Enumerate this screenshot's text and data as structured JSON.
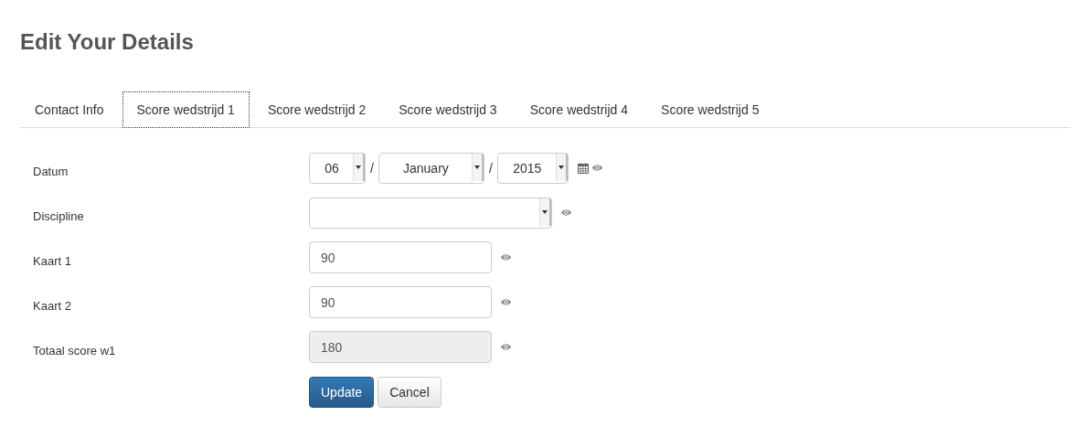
{
  "title": "Edit Your Details",
  "tabs": [
    {
      "label": "Contact Info",
      "selected": false
    },
    {
      "label": "Score wedstrijd 1",
      "selected": true
    },
    {
      "label": "Score wedstrijd 2",
      "selected": false
    },
    {
      "label": "Score wedstrijd 3",
      "selected": false
    },
    {
      "label": "Score wedstrijd 4",
      "selected": false
    },
    {
      "label": "Score wedstrijd 5",
      "selected": false
    }
  ],
  "fields": [
    {
      "kind": "date",
      "label": "Datum",
      "parts": [
        {
          "value": "06"
        },
        {
          "value": "January"
        },
        {
          "value": "2015"
        }
      ],
      "separator": "/"
    },
    {
      "kind": "select",
      "label": "Discipline"
    },
    {
      "kind": "text",
      "label": "Kaart 1",
      "value": "90",
      "disabled": false
    },
    {
      "kind": "text",
      "label": "Kaart 2",
      "value": "90",
      "disabled": false
    },
    {
      "kind": "text",
      "label": "Totaal score w1",
      "value": "180",
      "disabled": true
    }
  ],
  "buttons": [
    {
      "label": "Update",
      "kind": "primary"
    },
    {
      "label": "Cancel",
      "kind": "default"
    }
  ]
}
